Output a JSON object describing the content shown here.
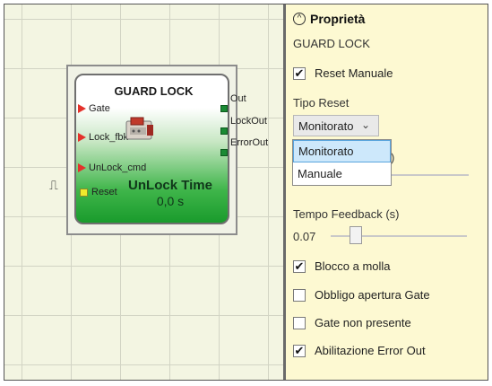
{
  "block": {
    "title": "GUARD LOCK",
    "inputs": [
      "Gate",
      "Lock_fbk",
      "UnLock_cmd",
      "Reset"
    ],
    "outputs": [
      "Out",
      "LockOut",
      "ErrorOut"
    ],
    "param_name": "UnLock Time",
    "param_value": "0,0 s",
    "reset_symbol": "⎍"
  },
  "panel": {
    "title": "Proprietà",
    "subtitle": "GUARD LOCK",
    "reset_manuale": {
      "label": "Reset Manuale",
      "checked": true
    },
    "tipo_reset": {
      "label": "Tipo Reset",
      "selected": "Monitorato",
      "options": [
        "Monitorato",
        "Manuale"
      ],
      "hidden_partial": ")"
    },
    "feedback": {
      "label": "Tempo Feedback (s)",
      "value": "0.07"
    },
    "options": [
      {
        "label": "Blocco a molla",
        "checked": true
      },
      {
        "label": "Obbligo apertura Gate",
        "checked": false
      },
      {
        "label": "Gate non presente",
        "checked": false
      },
      {
        "label": "Abilitazione Error Out",
        "checked": true
      }
    ]
  },
  "colors": {
    "accent": "#199b2c",
    "input_pin": "#e4322b",
    "output_pin": "#1a8a34",
    "selection": "#cde8fb"
  }
}
